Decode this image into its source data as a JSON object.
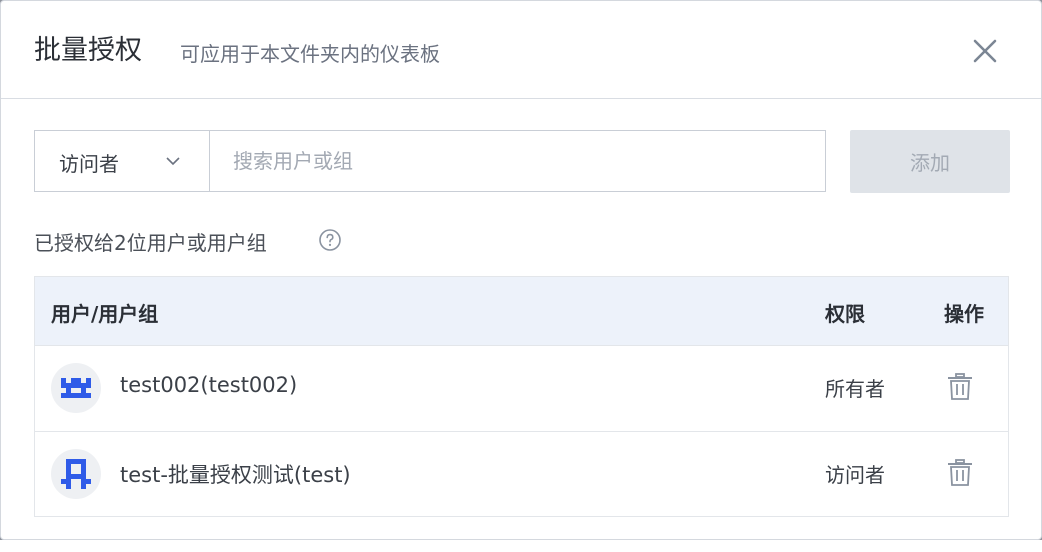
{
  "dialog": {
    "title": "批量授权",
    "subtitle": "可应用于本文件夹内的仪表板",
    "close_icon": "close-icon"
  },
  "form": {
    "role_select": {
      "value": "访问者",
      "icon": "chevron-down-icon"
    },
    "search": {
      "placeholder": "搜索用户或组",
      "value": ""
    },
    "add_label": "添加",
    "add_disabled": true
  },
  "granted_info": "已授权给2位用户或用户组",
  "table": {
    "headers": {
      "user": "用户/用户组",
      "permission": "权限",
      "action": "操作"
    },
    "rows": [
      {
        "name": "test002(test002)",
        "permission": "所有者",
        "avatar_color": "#2f5be8",
        "action_icon": "trash-icon"
      },
      {
        "name": "test-批量授权测试(test)",
        "permission": "访问者",
        "avatar_color": "#2f5be8",
        "action_icon": "trash-icon"
      }
    ]
  },
  "colors": {
    "accent": "#2f5be8",
    "header_bg": "#edf2fa",
    "disabled_button_bg": "#dfe3e8"
  }
}
